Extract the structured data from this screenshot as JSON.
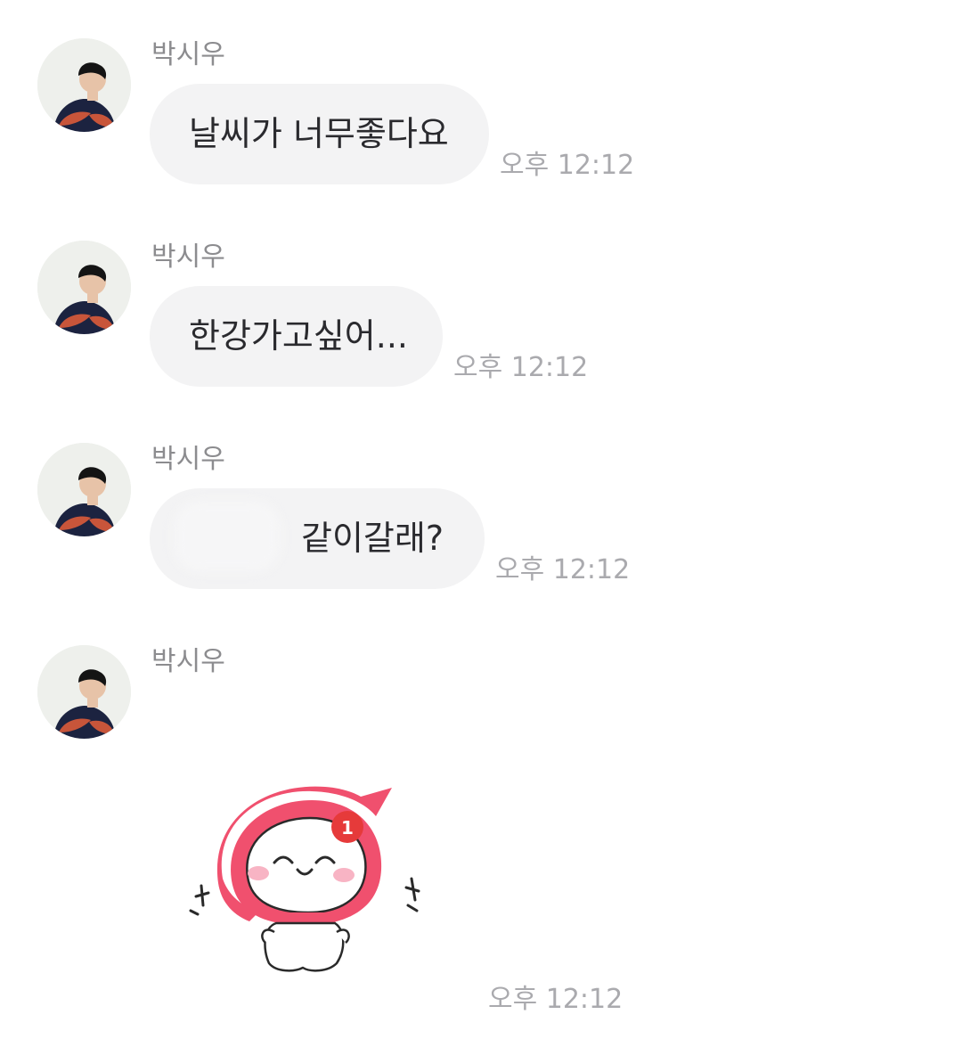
{
  "messages": [
    {
      "sender": "박시우",
      "text": "날씨가 너무좋다요",
      "time": "오후 12:12"
    },
    {
      "sender": "박시우",
      "text": "한강가고싶어...",
      "time": "오후 12:12"
    },
    {
      "sender": "박시우",
      "text": "같이갈래?",
      "time": "오후 12:12"
    },
    {
      "sender": "박시우",
      "sticker": {
        "icon": "happy-character-sticker",
        "badge": "1"
      },
      "time": "오후 12:12"
    }
  ],
  "colors": {
    "bubble_bg": "#f3f3f4",
    "sender_text": "#8c8c8f",
    "time_text": "#aaaaae",
    "sticker_accent": "#f0506e",
    "badge_red": "#e63a3a"
  }
}
